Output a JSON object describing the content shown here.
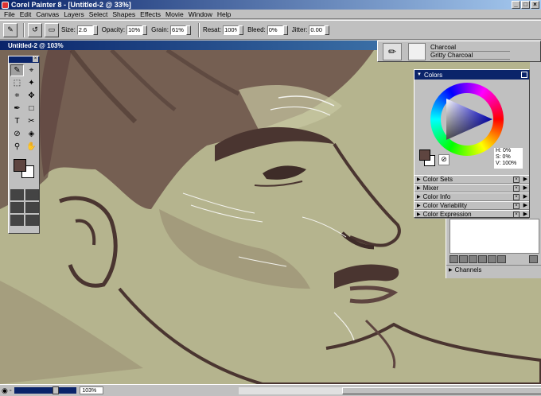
{
  "app": {
    "title": "Corel Painter 8 - [Untitled-2 @ 33%]"
  },
  "menu": [
    "File",
    "Edit",
    "Canvas",
    "Layers",
    "Select",
    "Shapes",
    "Effects",
    "Movie",
    "Window",
    "Help"
  ],
  "props": {
    "size_label": "Size:",
    "size_value": "2.6",
    "opacity_label": "Opacity:",
    "opacity_value": "10%",
    "grain_label": "Grain:",
    "grain_value": "61%",
    "resat_label": "Resat:",
    "resat_value": "100%",
    "bleed_label": "Bleed:",
    "bleed_value": "0%",
    "jitter_label": "Jitter:",
    "jitter_value": "0.00"
  },
  "document": {
    "title": "Untitled-2 @ 103%"
  },
  "brush": {
    "category": "Charcoal",
    "variant": "Gritty Charcoal"
  },
  "colors_panel": {
    "title": "Colors",
    "h_value": "H: 0%",
    "s_value": "S: 0%",
    "v_value": "V: 100%",
    "main_color": "#5e4540",
    "additional_color": "#ffffff",
    "sections": [
      "Color Sets",
      "Mixer",
      "Color Info",
      "Color Variability",
      "Color Expression"
    ]
  },
  "channels": {
    "title": "Channels"
  },
  "status": {
    "zoom": "103%"
  },
  "canvas_colors": {
    "paper": "#b5b48e",
    "ink": "#5e4540",
    "highlight": "#f3f3ee"
  }
}
